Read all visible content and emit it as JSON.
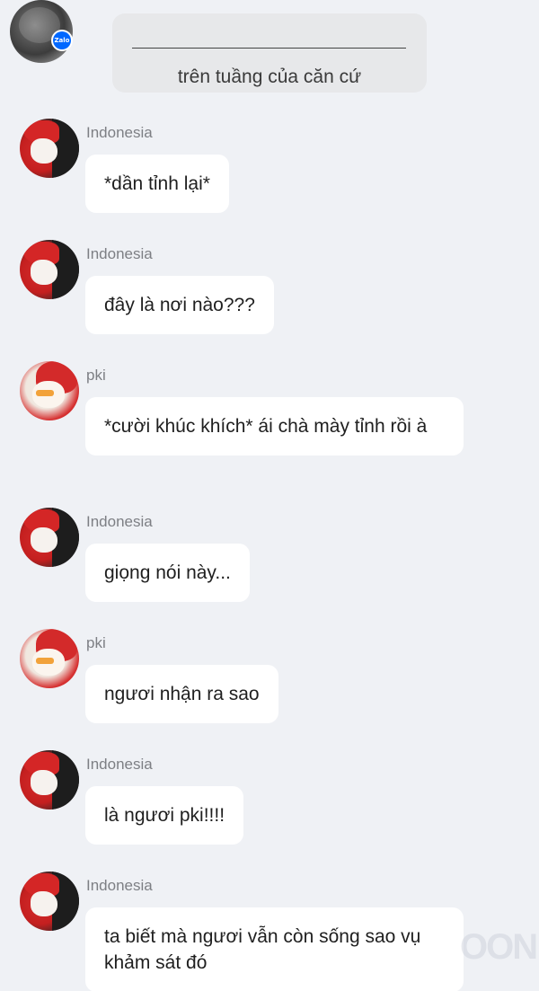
{
  "header": {
    "system_line": "______________________",
    "system_text": "trên tuầng của căn cứ",
    "badge_text": "Zalo"
  },
  "messages": [
    {
      "sender": "Indonesia",
      "text": "*dần tỉnh lại*"
    },
    {
      "sender": "Indonesia",
      "text": "đây là nơi nào???"
    },
    {
      "sender": "pki",
      "text": "*cười khúc khích* ái chà mày tỉnh rồi à"
    },
    {
      "sender": "Indonesia",
      "text": "giọng nói này..."
    },
    {
      "sender": "pki",
      "text": "ngươi nhận ra sao"
    },
    {
      "sender": "Indonesia",
      "text": "là ngươi pki!!!!"
    },
    {
      "sender": "Indonesia",
      "text": "ta biết mà ngươi vẫn còn sống sao vụ khảm sát đó"
    }
  ],
  "watermark": "OON"
}
